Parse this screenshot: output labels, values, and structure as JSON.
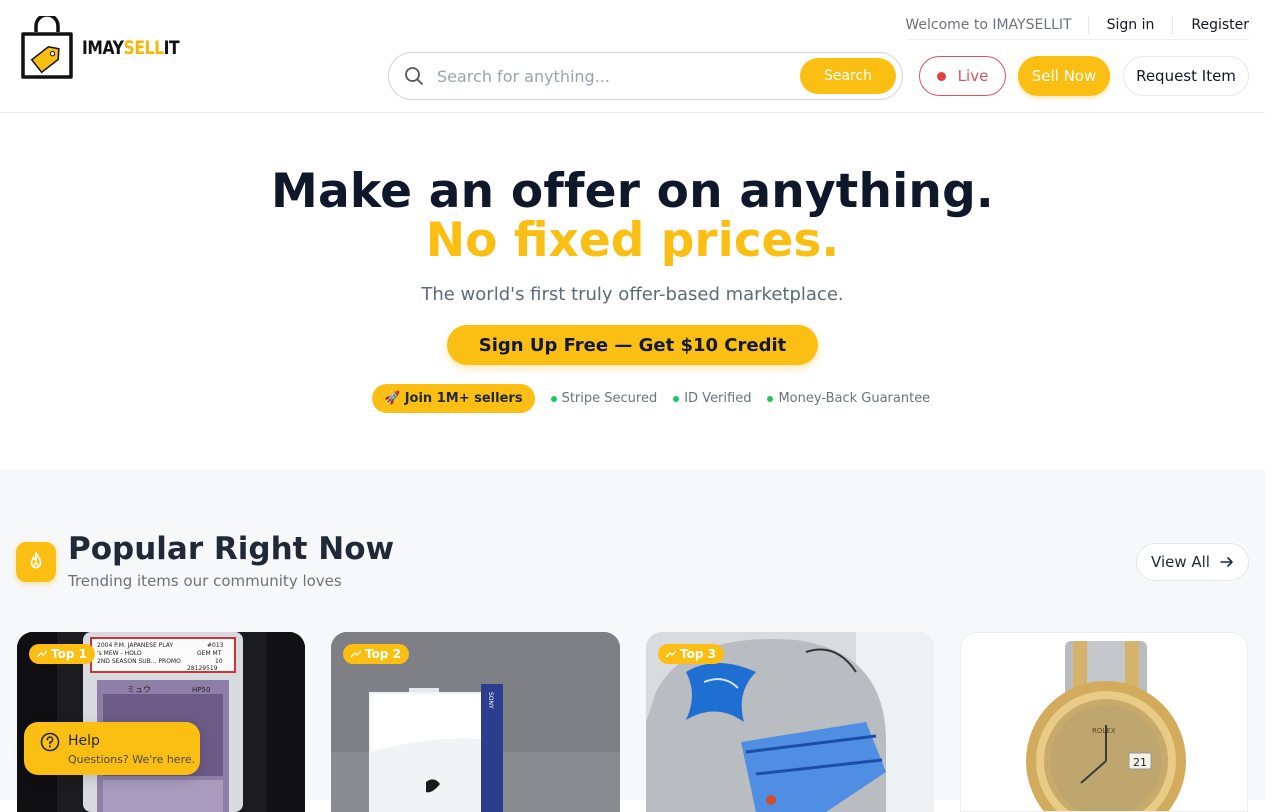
{
  "brand": {
    "name_dark": "IMAY",
    "name_gold": "SELL",
    "name_tail": "IT"
  },
  "toplinks": {
    "welcome": "Welcome to IMAYSELLIT",
    "signin": "Sign in",
    "register": "Register"
  },
  "search": {
    "placeholder": "Search for anything...",
    "button": "Search"
  },
  "nav": {
    "live": "Live",
    "sell_now": "Sell Now",
    "request_item": "Request Item"
  },
  "hero": {
    "title_line1": "Make an offer on anything.",
    "title_line2": "No fixed prices.",
    "subtitle": "The world's first truly offer-based marketplace.",
    "cta": "Sign Up Free — Get $10 Credit",
    "join_badge": "🚀 Join 1M+ sellers",
    "trust": [
      "Stripe Secured",
      "ID Verified",
      "Money-Back Guarantee"
    ]
  },
  "popular": {
    "title": "Popular Right Now",
    "subtitle": "Trending items our community loves",
    "view_all": "View All",
    "cards": [
      {
        "tag": "Top 1",
        "item": "graded card slab"
      },
      {
        "tag": "Top 2",
        "item": "game console box"
      },
      {
        "tag": "Top 3",
        "item": "signed football helmet"
      },
      {
        "tag": "",
        "item": "luxury wristwatch"
      }
    ]
  },
  "slab_label": {
    "line1": "2004 P.M. JAPANESE PLAY",
    "line2": "'s MEW - HOLO",
    "line3": "2ND SEASON SUB... PROMO",
    "grade1": "#013",
    "grade2": "GEM MT",
    "grade3": "10",
    "cert": "28129519",
    "card_name": "ミュウ",
    "hp": "HP50"
  },
  "console_brand": "SONY",
  "watch_brand": "ROLEX",
  "watch_date": "21",
  "help": {
    "title": "Help",
    "subtitle": "Questions? We're here."
  },
  "colors": {
    "accent": "#fbbf14",
    "live": "#e0525a",
    "trust_dot": "#22c55e",
    "title": "#0f172a"
  }
}
